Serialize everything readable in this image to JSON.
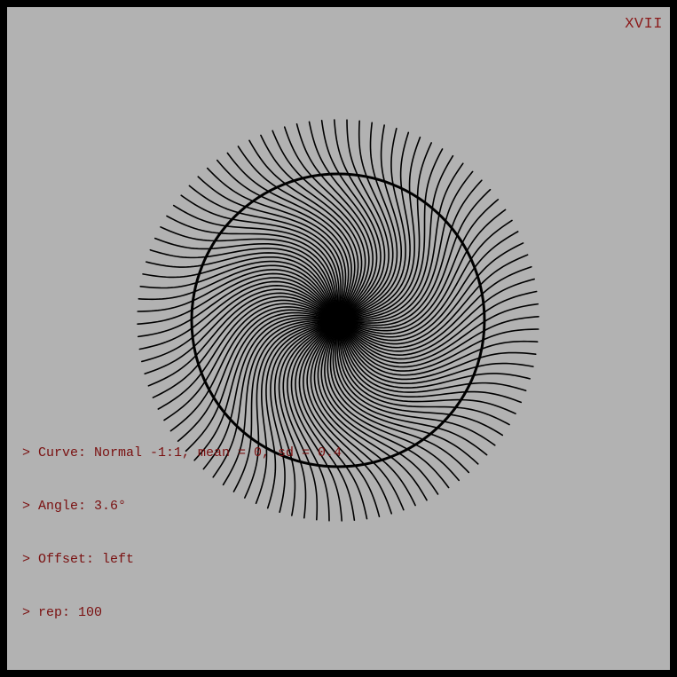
{
  "plate": {
    "number": "XVII"
  },
  "params": {
    "lines": [
      "> Curve: Normal -1:1, mean = 0, sd = 0.4",
      "> Angle: 3.6°",
      "> Offset: left",
      "> rep: 100"
    ]
  },
  "art": {
    "rep": 100,
    "angle_deg": 3.6,
    "curve_x_range": [
      -1,
      1
    ],
    "curve_mean": 0,
    "curve_sd": 0.4,
    "offset": "left",
    "stroke": "#000000",
    "background": "#b2b2b2"
  },
  "colors": {
    "frame": "#000000",
    "text": "#7a1010"
  }
}
